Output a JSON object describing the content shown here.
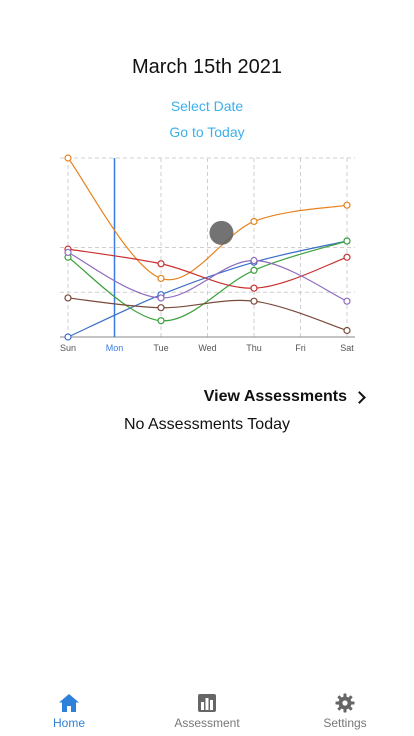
{
  "header": {
    "date_title": "March 15th 2021",
    "select_date_label": "Select Date",
    "go_to_today_label": "Go to Today"
  },
  "colors": {
    "link": "#3bb0ea",
    "active_tab": "#2f80d8",
    "inactive_tab": "#777777",
    "highlight_line": "#3a7be0"
  },
  "chart_data": {
    "type": "line",
    "categories": [
      "Sun",
      "Mon",
      "Tue",
      "Wed",
      "Thu",
      "Fri",
      "Sat"
    ],
    "highlighted_category": "Mon",
    "ylim": [
      0,
      11
    ],
    "grid": true,
    "series": [
      {
        "color": "#e8821e",
        "points": [
          [
            0,
            11
          ],
          [
            2,
            3.6
          ],
          [
            4,
            7.1
          ],
          [
            6,
            8.1
          ]
        ]
      },
      {
        "color": "#3a6fc9",
        "points": [
          [
            0,
            0
          ],
          [
            2,
            2.6
          ],
          [
            4,
            4.6
          ],
          [
            6,
            5.9
          ]
        ]
      },
      {
        "color": "#3aa03a",
        "points": [
          [
            0,
            4.9
          ],
          [
            2,
            1.0
          ],
          [
            4,
            4.1
          ],
          [
            6,
            5.9
          ]
        ]
      },
      {
        "color": "#c93030",
        "points": [
          [
            0,
            5.4
          ],
          [
            2,
            4.5
          ],
          [
            4,
            3.0
          ],
          [
            6,
            4.9
          ]
        ]
      },
      {
        "color": "#8e6bbf",
        "points": [
          [
            0,
            5.2
          ],
          [
            2,
            2.4
          ],
          [
            4,
            4.7
          ],
          [
            6,
            2.2
          ]
        ]
      },
      {
        "color": "#7a4a3a",
        "points": [
          [
            0,
            2.4
          ],
          [
            2,
            1.8
          ],
          [
            4,
            2.2
          ],
          [
            6,
            0.4
          ]
        ]
      }
    ]
  },
  "assessments": {
    "view_label": "View Assessments",
    "empty_message": "No Assessments Today"
  },
  "tabbar": {
    "items": [
      {
        "label": "Home",
        "icon": "home-icon",
        "active": true
      },
      {
        "label": "Assessment",
        "icon": "bar-chart-icon",
        "active": false
      },
      {
        "label": "Settings",
        "icon": "gear-icon",
        "active": false
      }
    ]
  }
}
